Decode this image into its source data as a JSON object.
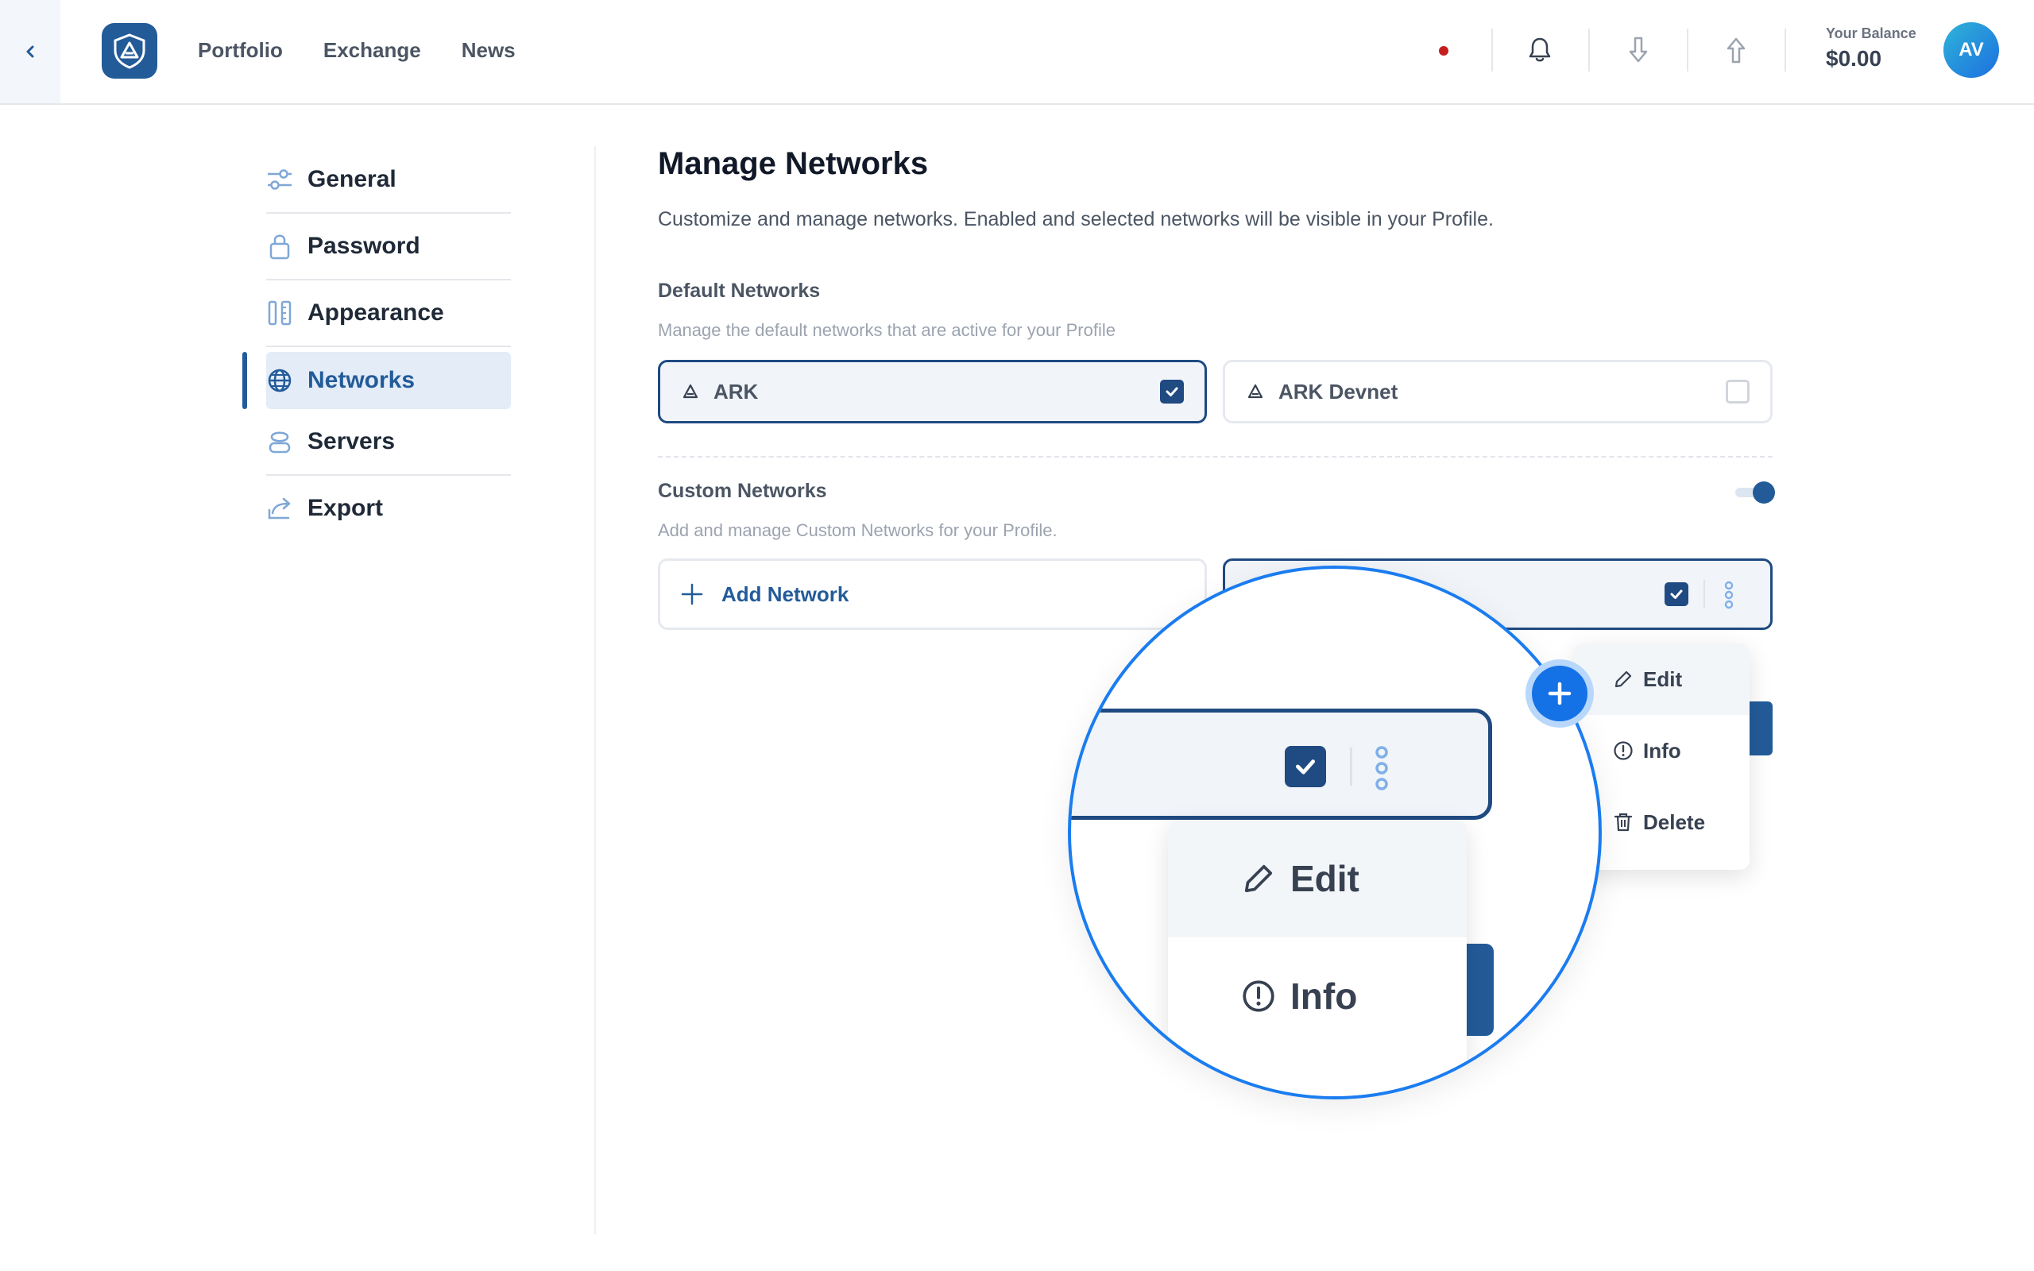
{
  "header": {
    "nav": [
      "Portfolio",
      "Exchange",
      "News"
    ],
    "balance_label": "Your Balance",
    "balance_value": "$0.00",
    "avatar_initials": "AV",
    "icons": [
      "chevron-left-icon",
      "ark-logo",
      "bell-icon",
      "receive-arrow-icon",
      "send-arrow-icon"
    ],
    "status_dot_color": "#c41e1e"
  },
  "sidebar": {
    "items": [
      {
        "label": "General",
        "icon": "sliders-icon"
      },
      {
        "label": "Password",
        "icon": "lock-icon"
      },
      {
        "label": "Appearance",
        "icon": "appearance-icon"
      },
      {
        "label": "Networks",
        "icon": "globe-icon",
        "active": true
      },
      {
        "label": "Servers",
        "icon": "server-icon"
      },
      {
        "label": "Export",
        "icon": "export-icon"
      }
    ]
  },
  "main": {
    "title": "Manage Networks",
    "subtitle": "Customize and manage networks. Enabled and selected networks will be visible in your Profile.",
    "default_networks": {
      "title": "Default Networks",
      "description": "Manage the default networks that are active for your Profile",
      "items": [
        {
          "name": "ARK",
          "checked": true
        },
        {
          "name": "ARK Devnet",
          "checked": false
        }
      ]
    },
    "custom_networks": {
      "title": "Custom Networks",
      "description": "Add and manage Custom Networks for your Profile.",
      "toggle_on": true,
      "add_label": "Add Network"
    },
    "dropdown": {
      "items": [
        {
          "label": "Edit",
          "icon": "pencil-icon"
        },
        {
          "label": "Info",
          "icon": "info-icon"
        },
        {
          "label": "Delete",
          "icon": "trash-icon"
        }
      ]
    },
    "magnifier": {
      "items": [
        {
          "label": "Edit",
          "icon": "pencil-icon"
        },
        {
          "label": "Info",
          "icon": "info-icon"
        }
      ]
    }
  },
  "colors": {
    "accent": "#235b99",
    "zoom_ring": "#1a7cf0"
  }
}
